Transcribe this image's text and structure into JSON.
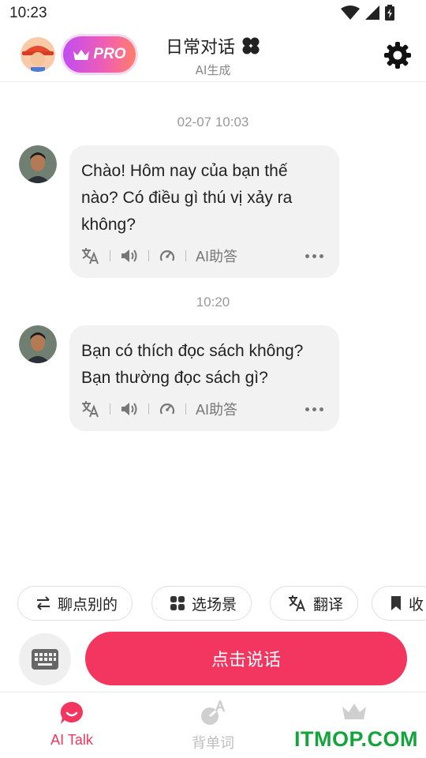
{
  "status_bar": {
    "time": "10:23"
  },
  "header": {
    "pro_label": "PRO",
    "title": "日常对话",
    "subtitle": "AI生成"
  },
  "messages": [
    {
      "timestamp": "02-07 10:03",
      "text": "Chào! Hôm nay của bạn thế nào? Có điều gì thú vị xảy ra không?",
      "ai_answer_label": "AI助答"
    },
    {
      "timestamp": "10:20",
      "text": "Bạn có thích đọc sách không? Bạn thường đọc sách gì?",
      "ai_answer_label": "AI助答"
    }
  ],
  "chips": [
    {
      "label": "聊点别的",
      "icon": "swap-icon"
    },
    {
      "label": "选场景",
      "icon": "grid-icon"
    },
    {
      "label": "翻译",
      "icon": "translate-icon"
    },
    {
      "label": "收",
      "icon": "bookmark-icon"
    }
  ],
  "talk_button": "点击说话",
  "bottom_nav": [
    {
      "label": "AI Talk",
      "active": true
    },
    {
      "label": "背单词",
      "active": false
    },
    {
      "label": "",
      "active": false
    }
  ],
  "watermark": "ITMOP.COM",
  "colors": {
    "accent": "#f2365f",
    "watermark": "#14a33c"
  }
}
